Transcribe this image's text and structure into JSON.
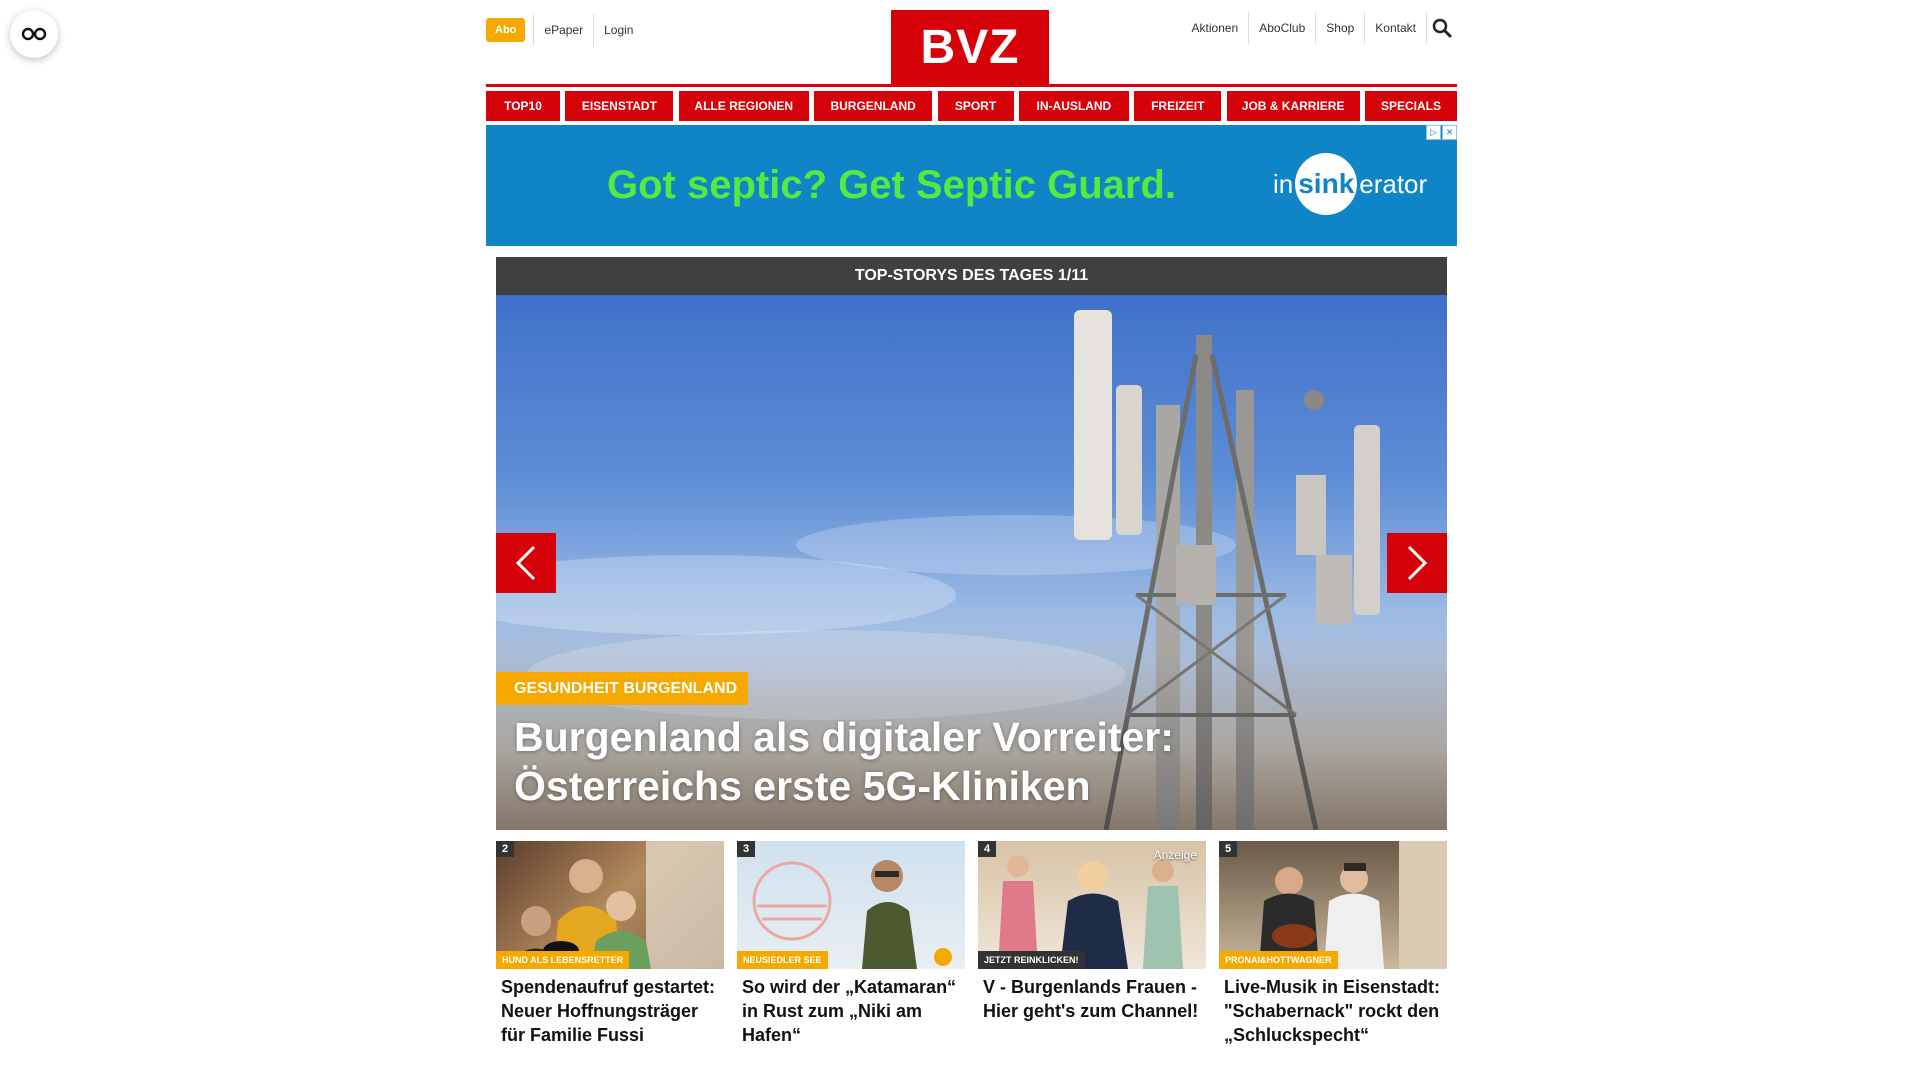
{
  "top": {
    "abo_label": "Abo",
    "left_links": [
      "ePaper",
      "Login"
    ],
    "logo_text": "BVZ",
    "right_links": [
      "Aktionen",
      "AboClub",
      "Shop",
      "Kontakt"
    ]
  },
  "nav": {
    "items": [
      "TOP10",
      "EISENSTADT",
      "ALLE REGIONEN",
      "BURGENLAND",
      "SPORT",
      "IN-AUSLAND",
      "FREIZEIT",
      "JOB & KARRIERE",
      "SPECIALS"
    ]
  },
  "ad": {
    "headline": "Got septic? Get Septic Guard.",
    "brand_in": "in",
    "brand_sink": "sink",
    "brand_erator": "erator",
    "headline_color": "#55ea3f",
    "background_color": "#0f84c7"
  },
  "hero": {
    "section_header": "TOP-STORYS DES TAGES 1/11",
    "tag": "GESUNDHEIT BURGENLAND",
    "title": "Burgenland als digitaler Vorreiter: Österreichs erste 5G-Kliniken"
  },
  "cards": [
    {
      "num": "2",
      "tag": "HUND ALS LEBENSRETTER",
      "title": "Spendenaufruf gestartet: Neuer Hoffnungsträger für Familie Fussi"
    },
    {
      "num": "3",
      "tag": "NEUSIEDLER SEE",
      "title": "So wird der „Katamaran“ in Rust zum „Niki am Hafen“"
    },
    {
      "num": "4",
      "tag": "JETZT REINKLICKEN!",
      "title": "V - Burgenlands Frauen - Hier geht's zum Channel!",
      "badge": "Anzeige"
    },
    {
      "num": "5",
      "tag": "PRONAI&HOTTWAGNER",
      "title": "Live-Musik in Eisenstadt: \"Schabernack\" rockt den „Schluckspecht“"
    }
  ],
  "colors": {
    "brand_red": "#d6020a",
    "accent_orange": "#f5a800",
    "dark_header": "#404040"
  },
  "icons": [
    "reader-mode-icon",
    "search-icon",
    "chevron-left-icon",
    "chevron-right-icon",
    "adchoices-icon",
    "close-icon"
  ]
}
